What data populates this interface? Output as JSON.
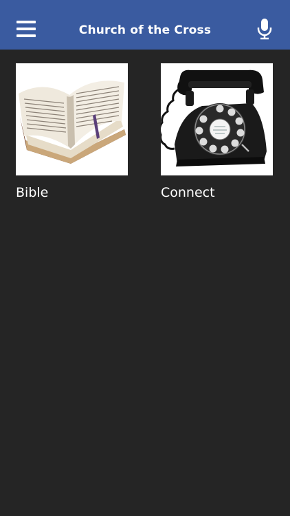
{
  "header": {
    "title": "Church of the Cross",
    "menu_icon": "hamburger-menu-icon",
    "mic_icon": "microphone-icon",
    "bg_color": "#3a5ba0"
  },
  "tiles": [
    {
      "label": "Bible",
      "image": "open-bible-image"
    },
    {
      "label": "Connect",
      "image": "rotary-telephone-image"
    }
  ],
  "colors": {
    "background": "#252525",
    "text": "#ffffff"
  }
}
